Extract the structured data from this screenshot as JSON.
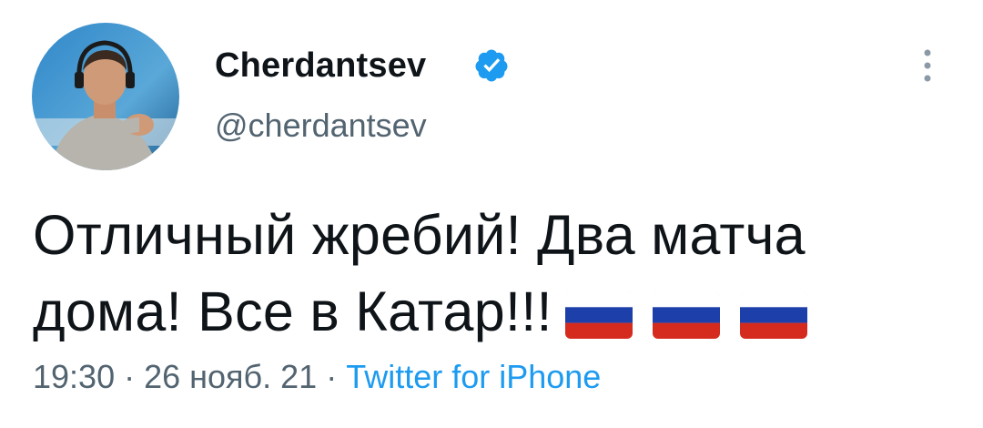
{
  "author": {
    "display_name": "Cherdantsev",
    "handle": "@cherdantsev",
    "verified_icon": "verified-badge-icon",
    "avatar_icon": "avatar-image"
  },
  "tweet": {
    "text": "Отличный жребий! Два матча дома! Все в Катар!!!",
    "flags": [
      "russia-flag",
      "russia-flag",
      "russia-flag"
    ]
  },
  "meta": {
    "time": "19:30",
    "sep1": " · ",
    "date": "26 нояб. 21",
    "sep2": " · ",
    "source": "Twitter for iPhone"
  },
  "colors": {
    "text": "#0f1419",
    "secondary": "#536471",
    "accent": "#1d9bf0"
  },
  "more_icon": "more-vertical-icon"
}
